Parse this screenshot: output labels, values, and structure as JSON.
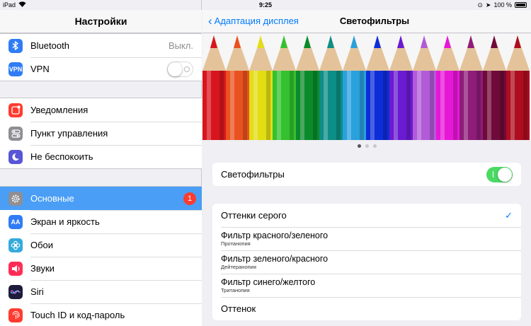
{
  "statusbar": {
    "device": "iPad",
    "time": "9:25",
    "battery": "100 %"
  },
  "master": {
    "title": "Настройки",
    "group1": [
      {
        "label": "Bluetooth",
        "value": "Выкл.",
        "icon": "bluetooth-icon",
        "color": "#2f7cf6"
      },
      {
        "label": "VPN",
        "icon": "vpn-icon",
        "icon_text": "VPN",
        "color": "#2f7cf6",
        "toggle": false
      }
    ],
    "group2": [
      {
        "label": "Уведомления",
        "icon": "notifications-icon",
        "color": "#ff3b30"
      },
      {
        "label": "Пункт управления",
        "icon": "control-center-icon",
        "color": "#8e8e93"
      },
      {
        "label": "Не беспокоить",
        "icon": "moon-icon",
        "color": "#5856d6"
      }
    ],
    "group3": [
      {
        "label": "Основные",
        "icon": "gear-icon",
        "color": "#8e8e93",
        "badge": "1",
        "selected": true
      },
      {
        "label": "Экран и яркость",
        "icon": "display-icon",
        "icon_text": "AA",
        "color": "#2f7cf6"
      },
      {
        "label": "Обои",
        "icon": "wallpaper-icon",
        "color": "#34aadc"
      },
      {
        "label": "Звуки",
        "icon": "speaker-icon",
        "color": "#ff2d55"
      },
      {
        "label": "Siri",
        "icon": "siri-icon",
        "color": "#1c1c3a"
      },
      {
        "label": "Touch ID и код-пароль",
        "icon": "fingerprint-icon",
        "color": "#ff3b30"
      }
    ]
  },
  "detail": {
    "back_label": "Адаптация дисплея",
    "title": "Светофильтры",
    "pencil_colors": [
      "#d8151c",
      "#e9521f",
      "#e3dd13",
      "#34c12f",
      "#0b8a2b",
      "#0d8e86",
      "#2aa0dc",
      "#0d2dd8",
      "#6a1bd1",
      "#b25bd8",
      "#e717d8",
      "#8e1c78",
      "#6f0a3a",
      "#ad0d1f"
    ],
    "page_dots": 3,
    "active_dot": 0,
    "filters_toggle_label": "Светофильтры",
    "filters_toggle_on": true,
    "options": [
      {
        "label": "Оттенки серого",
        "checked": true
      },
      {
        "label": "Фильтр красного/зеленого",
        "sub": "Протанопия"
      },
      {
        "label": "Фильтр зеленого/красного",
        "sub": "Дейтеранопия"
      },
      {
        "label": "Фильтр синего/желтого",
        "sub": "Тританопия"
      },
      {
        "label": "Оттенок"
      }
    ]
  }
}
